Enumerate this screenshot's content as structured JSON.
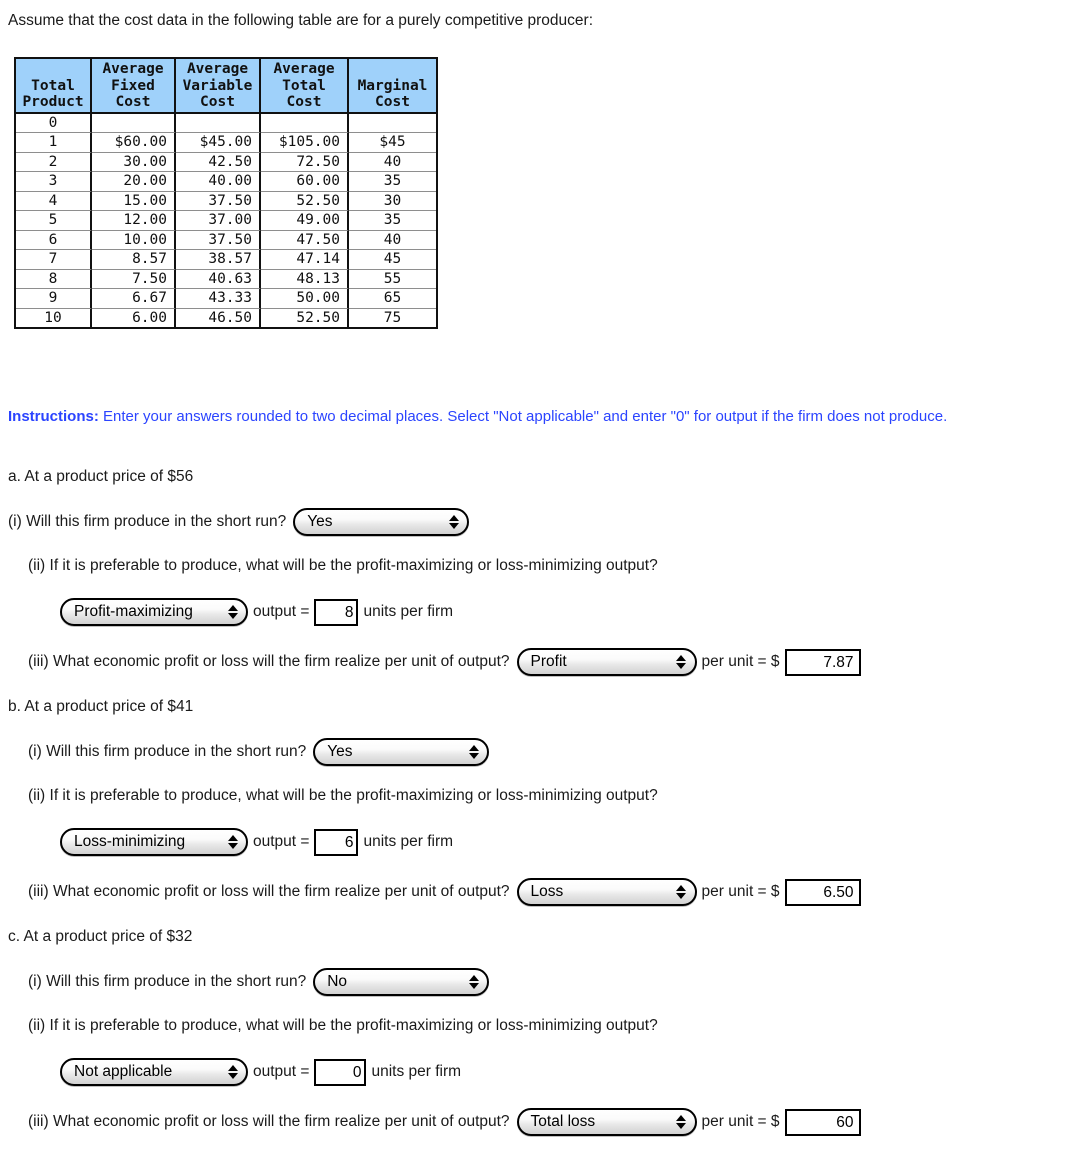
{
  "intro": "Assume that the cost data in the following table are for a purely competitive producer:",
  "table": {
    "headers": [
      {
        "line1": "Total",
        "line2": "Product"
      },
      {
        "line1": "Average",
        "line2": "Fixed",
        "line3": "Cost"
      },
      {
        "line1": "Average",
        "line2": "Variable",
        "line3": "Cost"
      },
      {
        "line1": "Average",
        "line2": "Total",
        "line3": "Cost"
      },
      {
        "line1": "Marginal",
        "line2": "Cost"
      }
    ],
    "rows": [
      {
        "tp": "0",
        "afc": "",
        "avc": "",
        "atc": "",
        "mc": ""
      },
      {
        "tp": "1",
        "afc": "$60.00",
        "avc": "$45.00",
        "atc": "$105.00",
        "mc": "$45"
      },
      {
        "tp": "2",
        "afc": "30.00",
        "avc": "42.50",
        "atc": "72.50",
        "mc": "40"
      },
      {
        "tp": "3",
        "afc": "20.00",
        "avc": "40.00",
        "atc": "60.00",
        "mc": "35"
      },
      {
        "tp": "4",
        "afc": "15.00",
        "avc": "37.50",
        "atc": "52.50",
        "mc": "30"
      },
      {
        "tp": "5",
        "afc": "12.00",
        "avc": "37.00",
        "atc": "49.00",
        "mc": "35"
      },
      {
        "tp": "6",
        "afc": "10.00",
        "avc": "37.50",
        "atc": "47.50",
        "mc": "40"
      },
      {
        "tp": "7",
        "afc": "8.57",
        "avc": "38.57",
        "atc": "47.14",
        "mc": "45"
      },
      {
        "tp": "8",
        "afc": "7.50",
        "avc": "40.63",
        "atc": "48.13",
        "mc": "55"
      },
      {
        "tp": "9",
        "afc": "6.67",
        "avc": "43.33",
        "atc": "50.00",
        "mc": "65"
      },
      {
        "tp": "10",
        "afc": "6.00",
        "avc": "46.50",
        "atc": "52.50",
        "mc": "75"
      }
    ]
  },
  "instructions": {
    "bold_label": "Instructions:",
    "text": " Enter your answers rounded to two decimal places. Select \"Not applicable\" and enter \"0\" for output if the firm does not produce."
  },
  "sections": {
    "a": {
      "heading": "a. At a product price of $56",
      "q1_label": "(i) Will this firm produce in the short run?",
      "q1_select": "Yes",
      "q2_label": "(ii) If it is preferable to produce, what will be the profit-maximizing or loss-minimizing output?",
      "q2_select": "Profit-maximizing",
      "q2_output_label": "output =",
      "q2_value": "8",
      "q2_units": "units per firm",
      "q3_label": "(iii) What economic profit or loss will the firm realize per unit of output?",
      "q3_select": "Profit",
      "q3_perunit_label": "per unit = $",
      "q3_value": "7.87"
    },
    "b": {
      "heading": "b. At a product price of $41",
      "q1_label": "(i) Will this firm produce in the short run?",
      "q1_select": "Yes",
      "q2_label": "(ii) If it is preferable to produce, what will be the profit-maximizing or loss-minimizing output?",
      "q2_select": "Loss-minimizing",
      "q2_output_label": "output =",
      "q2_value": "6",
      "q2_units": "units per firm",
      "q3_label": "(iii) What economic profit or loss will the firm realize per unit of output?",
      "q3_select": "Loss",
      "q3_perunit_label": "per unit = $",
      "q3_value": "6.50"
    },
    "c": {
      "heading": "c. At a product price of $32",
      "q1_label": "(i) Will this firm produce in the short run?",
      "q1_select": "No",
      "q2_label": "(ii) If it is preferable to produce, what will be the profit-maximizing or loss-minimizing output?",
      "q2_select": "Not applicable",
      "q2_output_label": "output =",
      "q2_value": "0",
      "q2_units": "units per firm",
      "q3_label": "(iii) What economic profit or loss will the firm realize per unit of output?",
      "q3_select": "Total loss",
      "q3_perunit_label": "per unit = $",
      "q3_value": "60"
    }
  },
  "colors": {
    "header_blue": "#9fd1fa",
    "instruction_blue": "#2b44ff"
  }
}
